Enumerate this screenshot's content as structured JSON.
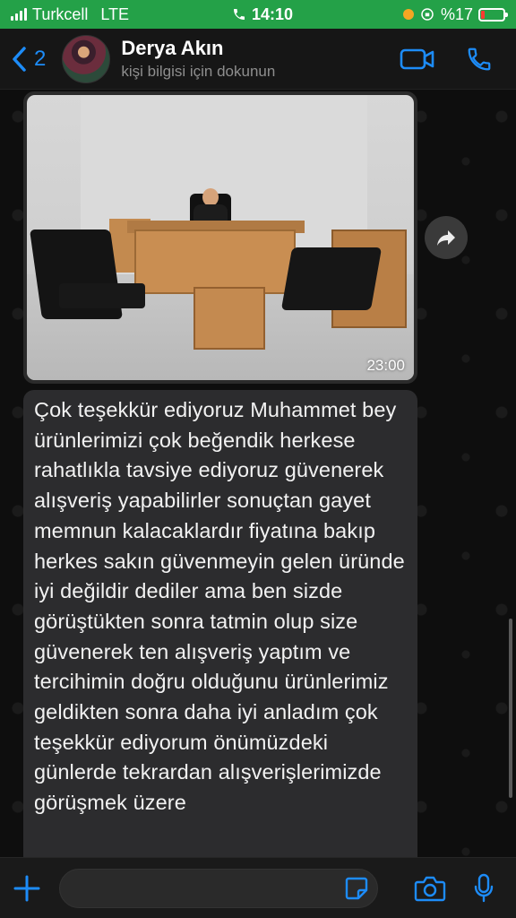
{
  "status_bar": {
    "carrier": "Turkcell",
    "network": "LTE",
    "time": "14:10",
    "battery_percent": "%17",
    "battery_level": 0.17,
    "accent_color": "#24a148"
  },
  "header": {
    "back_count": "2",
    "contact_name": "Derya Akın",
    "contact_subtitle": "kişi bilgisi için dokunun",
    "icons": [
      "video-camera-icon",
      "phone-icon"
    ]
  },
  "messages": [
    {
      "type": "image",
      "time": "23:00"
    },
    {
      "type": "text",
      "text": "Çok teşekkür ediyoruz Muhammet bey ürünlerimizi çok beğendik herkese rahatlıkla tavsiye ediyoruz güvenerek alışveriş yapabilirler sonuçtan gayet memnun kalacaklardır fiyatına bakıp herkes sakın güvenmeyin gelen üründe iyi değildir dediler ama ben sizde görüştükten sonra tatmin olup size güvenerek ten alışveriş yaptım ve tercihimin doğru olduğunu ürünlerimiz geldikten sonra daha iyi anladım çok teşekkür ediyorum önümüzdeki günlerde tekrardan alışverişlerimizde görüşmek üzere"
    }
  ],
  "input_bar": {
    "message_value": "",
    "icons": [
      "plus-icon",
      "sticker-icon",
      "camera-icon",
      "microphone-icon"
    ]
  }
}
